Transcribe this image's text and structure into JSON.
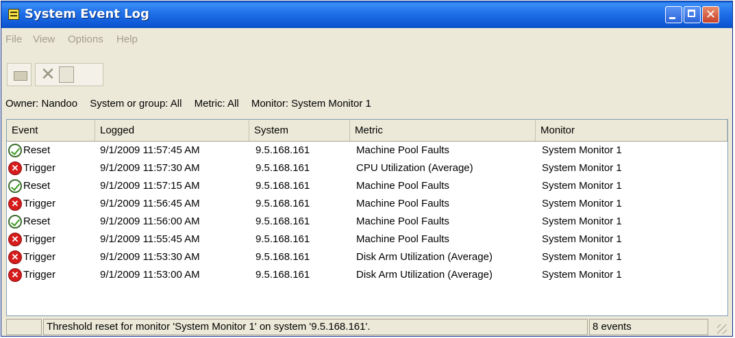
{
  "window": {
    "title": "System Event Log"
  },
  "menu": [
    "File",
    "View",
    "Options",
    "Help"
  ],
  "toolbar": {
    "icons": [
      "open-folder-icon",
      "delete-icon",
      "properties-icon"
    ]
  },
  "filter": {
    "owner": "Owner: Nandoo",
    "system": "System or group: All",
    "metric": "Metric: All",
    "monitor": "Monitor: System Monitor 1"
  },
  "table": {
    "columns": [
      "Event",
      "Logged",
      "System",
      "Metric",
      "Monitor"
    ],
    "rows": [
      {
        "type": "reset",
        "event": "Reset",
        "logged": "9/1/2009 11:57:45 AM",
        "system": "9.5.168.161",
        "metric": "Machine Pool Faults",
        "monitor": "System Monitor 1"
      },
      {
        "type": "trigger",
        "event": "Trigger",
        "logged": "9/1/2009 11:57:30 AM",
        "system": "9.5.168.161",
        "metric": "CPU Utilization (Average)",
        "monitor": "System Monitor 1"
      },
      {
        "type": "reset",
        "event": "Reset",
        "logged": "9/1/2009 11:57:15 AM",
        "system": "9.5.168.161",
        "metric": "Machine Pool Faults",
        "monitor": "System Monitor 1"
      },
      {
        "type": "trigger",
        "event": "Trigger",
        "logged": "9/1/2009 11:56:45 AM",
        "system": "9.5.168.161",
        "metric": "Machine Pool Faults",
        "monitor": "System Monitor 1"
      },
      {
        "type": "reset",
        "event": "Reset",
        "logged": "9/1/2009 11:56:00 AM",
        "system": "9.5.168.161",
        "metric": "Machine Pool Faults",
        "monitor": "System Monitor 1"
      },
      {
        "type": "trigger",
        "event": "Trigger",
        "logged": "9/1/2009 11:55:45 AM",
        "system": "9.5.168.161",
        "metric": "Machine Pool Faults",
        "monitor": "System Monitor 1"
      },
      {
        "type": "trigger",
        "event": "Trigger",
        "logged": "9/1/2009 11:53:30 AM",
        "system": "9.5.168.161",
        "metric": "Disk Arm Utilization (Average)",
        "monitor": "System Monitor 1"
      },
      {
        "type": "trigger",
        "event": "Trigger",
        "logged": "9/1/2009 11:53:00 AM",
        "system": "9.5.168.161",
        "metric": "Disk Arm Utilization (Average)",
        "monitor": "System Monitor 1"
      }
    ]
  },
  "status": {
    "message": "Threshold reset for monitor 'System Monitor 1' on system '9.5.168.161'.",
    "count": "8 events"
  },
  "colors": {
    "title_bar": "#1f6fe8",
    "window_bg": "#ece9d8",
    "reset_icon": "#3a9d1a",
    "trigger_icon": "#d61c1c"
  }
}
